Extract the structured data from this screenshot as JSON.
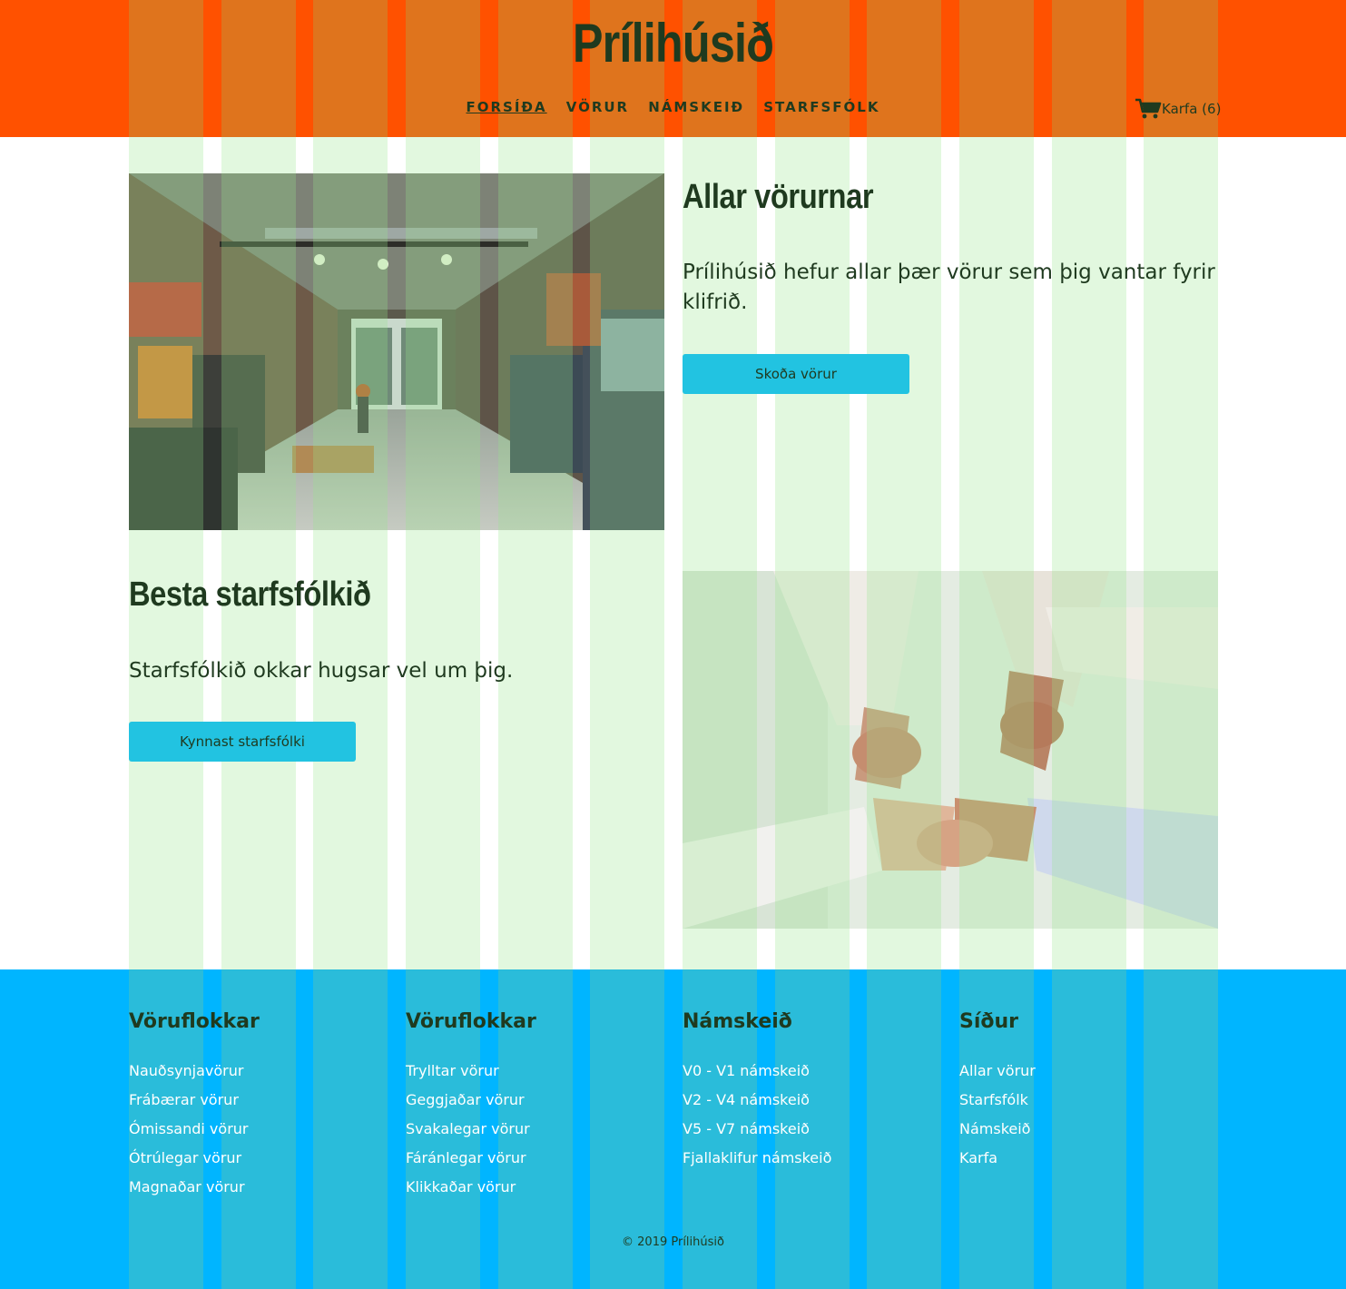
{
  "site": {
    "title": "Prílihúsið"
  },
  "nav": {
    "items": [
      {
        "label": "FORSÍÐA",
        "active": true
      },
      {
        "label": "VÖRUR",
        "active": false
      },
      {
        "label": "NÁMSKEIÐ",
        "active": false
      },
      {
        "label": "STARFSFÓLK",
        "active": false
      }
    ],
    "cart_label": "Karfa (6)",
    "cart_icon": "shopping-cart-icon"
  },
  "sections": {
    "products": {
      "title": "Allar vörurnar",
      "text": "Prílihúsið hefur allar þær vörur sem þig vantar fyrir klifrið.",
      "button": "Skoða vörur"
    },
    "staff": {
      "title": "Besta starfsfólkið",
      "text": "Starfsfólkið okkar hugsar vel um þig.",
      "button": "Kynnast starfsfólki"
    }
  },
  "footer": {
    "columns": [
      {
        "heading": "Vöruflokkar",
        "links": [
          "Nauðsynjavörur",
          "Frábærar vörur",
          "Ómissandi vörur",
          "Ótrúlegar vörur",
          "Magnaðar vörur"
        ]
      },
      {
        "heading": "Vöruflokkar",
        "links": [
          "Trylltar vörur",
          "Geggjaðar vörur",
          "Svakalegar vörur",
          "Fáránlegar vörur",
          "Klikkaðar vörur"
        ]
      },
      {
        "heading": "Námskeið",
        "links": [
          "V0 - V1 námskeið",
          "V2 - V4 námskeið",
          "V5 - V7 námskeið",
          "Fjallaklifur námskeið"
        ]
      },
      {
        "heading": "Síður",
        "links": [
          "Allar vörur",
          "Starfsfólk",
          "Námskeið",
          "Karfa"
        ]
      }
    ],
    "copyright": "© 2019 Prílihúsið"
  },
  "colors": {
    "header_bg": "#ff5100",
    "footer_bg": "#00b5ff",
    "button_bg": "#22c3e1",
    "text_dark": "#1f3a1f",
    "footer_link": "#ffffff"
  }
}
